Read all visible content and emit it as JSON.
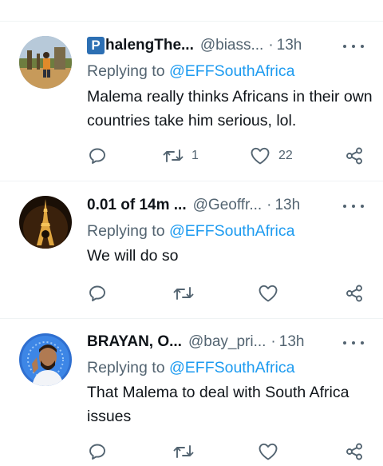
{
  "tweets": [
    {
      "name_badge": "P",
      "name": "halengThe...",
      "handle": "@biass...",
      "dot": "·",
      "time": "13h",
      "reply_prefix": "Replying to",
      "reply_mention": "@EFFSouthAfrica",
      "body": "Malema really thinks Africans in their own countries take him serious, lol.",
      "retweet_count": "1",
      "like_count": "22"
    },
    {
      "name": "0.01 of 14m ...",
      "handle": "@Geoffr...",
      "dot": "·",
      "time": "13h",
      "reply_prefix": "Replying to",
      "reply_mention": "@EFFSouthAfrica",
      "body": "We will do so",
      "retweet_count": "",
      "like_count": ""
    },
    {
      "name": "BRAYAN, O...",
      "handle": "@bay_pri...",
      "dot": "·",
      "time": "13h",
      "reply_prefix": "Replying to",
      "reply_mention": "@EFFSouthAfrica",
      "body": "That Malema to deal with South Africa issues",
      "retweet_count": "",
      "like_count": ""
    }
  ],
  "icons": {
    "reply": "reply-icon",
    "retweet": "retweet-icon",
    "like": "heart-icon",
    "share": "share-icon",
    "more": "more-icon"
  },
  "colors": {
    "mention": "#1d9bf0",
    "secondary_text": "#536471",
    "divider": "#eff3f4"
  }
}
